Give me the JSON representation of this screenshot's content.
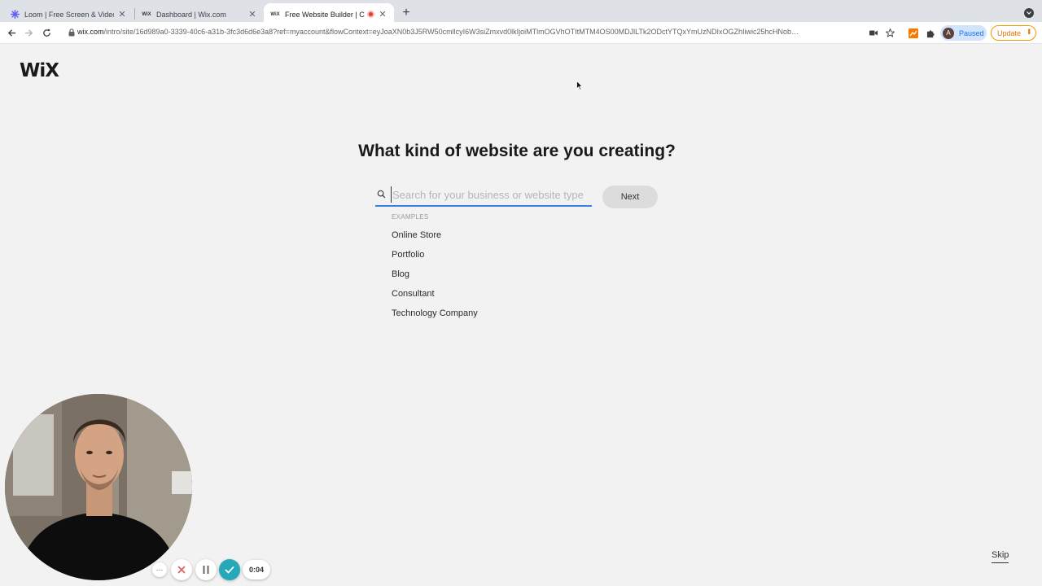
{
  "tabs": [
    {
      "title": "Loom | Free Screen & Video Re",
      "favicon": "loom-icon"
    },
    {
      "title": "Dashboard | Wix.com",
      "favicon": "wix-icon"
    },
    {
      "title": "Free Website Builder | Crea",
      "favicon": "wix-icon",
      "active": true,
      "recording": true
    }
  ],
  "toolbar": {
    "url_host": "wix.com",
    "url_rest": "/intro/site/16d989a0-3339-40c6-a31b-3fc3d6d6e3a8?ref=myaccount&flowContext=eyJoaXN0b3J5RW50cmllcyI6W3siZmxvd0lkIjoiMTlmOGVhOTItMTM4OS00MDJlLTk2ODctYTQxYmUzNDIxOGZhIiwic25hcHNob…",
    "profile_initial": "A",
    "profile_status": "Paused",
    "update_label": "Update"
  },
  "page": {
    "logo": "WiX",
    "heading": "What kind of website are you creating?",
    "search_placeholder": "Search for your business or website type",
    "next_label": "Next",
    "examples_heading": "EXAMPLES",
    "examples": [
      "Online Store",
      "Portfolio",
      "Blog",
      "Consultant",
      "Technology Company"
    ],
    "skip_label": "Skip"
  },
  "loom": {
    "timer": "0:04"
  },
  "colors": {
    "accent_underline": "#3a7ee7",
    "loom_check": "#26a8b8",
    "loom_cancel": "#e35d5d"
  }
}
